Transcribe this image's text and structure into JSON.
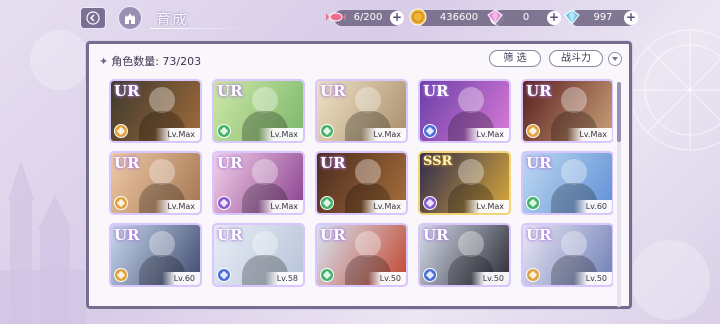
{
  "header": {
    "title": "育成",
    "resources": [
      {
        "name": "stamina",
        "icon": "candy-icon",
        "value": "6/200"
      },
      {
        "name": "gold",
        "icon": "gold-coin-icon",
        "value": "436600"
      },
      {
        "name": "gem-pink",
        "icon": "pink-diamond-icon",
        "value": "0"
      },
      {
        "name": "gem-blue",
        "icon": "blue-diamond-icon",
        "value": "997"
      }
    ]
  },
  "panel": {
    "count_label": "角色数量: 73/203",
    "filter_label": "筛 选",
    "sort_label": "战斗力"
  },
  "colors": {
    "frame": "#776c90",
    "ur_glow": "#a779d9",
    "ssr_glow": "#c69a2a"
  },
  "cards": [
    {
      "rarity": "UR",
      "level": "Lv.Max",
      "attr_color": "#e0a23a",
      "art": [
        "#3e3a2e",
        "#a06b3a"
      ]
    },
    {
      "rarity": "UR",
      "level": "Lv.Max",
      "attr_color": "#43b36a",
      "art": [
        "#cfe7a8",
        "#7bb86a"
      ]
    },
    {
      "rarity": "UR",
      "level": "Lv.Max",
      "attr_color": "#43b36a",
      "art": [
        "#efe3c7",
        "#a98e6a"
      ]
    },
    {
      "rarity": "UR",
      "level": "Lv.Max",
      "attr_color": "#4a6fd6",
      "art": [
        "#6a3fa8",
        "#d97ad6"
      ]
    },
    {
      "rarity": "UR",
      "level": "Lv.Max",
      "attr_color": "#e0a23a",
      "art": [
        "#5a1e1e",
        "#caa27a"
      ]
    },
    {
      "rarity": "UR",
      "level": "Lv.Max",
      "attr_color": "#e0a23a",
      "art": [
        "#f0c9a8",
        "#a2754e"
      ]
    },
    {
      "rarity": "UR",
      "level": "Lv.Max",
      "attr_color": "#8a5ad0",
      "art": [
        "#f3d1e8",
        "#8a3f8f"
      ]
    },
    {
      "rarity": "UR",
      "level": "Lv.Max",
      "attr_color": "#43b36a",
      "art": [
        "#4a2a1e",
        "#a8703a"
      ]
    },
    {
      "rarity": "SSR",
      "level": "Lv.Max",
      "attr_color": "#8a5ad0",
      "art": [
        "#2e2a4e",
        "#d9a93a"
      ]
    },
    {
      "rarity": "UR",
      "level": "Lv.60",
      "attr_color": "#43b36a",
      "art": [
        "#bfdaf2",
        "#5f8fd6"
      ]
    },
    {
      "rarity": "UR",
      "level": "Lv.60",
      "attr_color": "#e0a23a",
      "art": [
        "#c8d7ee",
        "#3e4a6e"
      ]
    },
    {
      "rarity": "UR",
      "level": "Lv.58",
      "attr_color": "#4a6fd6",
      "art": [
        "#e8eef6",
        "#b7c3d8"
      ]
    },
    {
      "rarity": "UR",
      "level": "Lv.50",
      "attr_color": "#43b36a",
      "art": [
        "#d7e6f5",
        "#c2462e"
      ]
    },
    {
      "rarity": "UR",
      "level": "Lv.50",
      "attr_color": "#4a6fd6",
      "art": [
        "#d6dcea",
        "#2a2a36"
      ]
    },
    {
      "rarity": "UR",
      "level": "Lv.50",
      "attr_color": "#e0a23a",
      "art": [
        "#e9e6f5",
        "#6f7fb5"
      ]
    }
  ]
}
